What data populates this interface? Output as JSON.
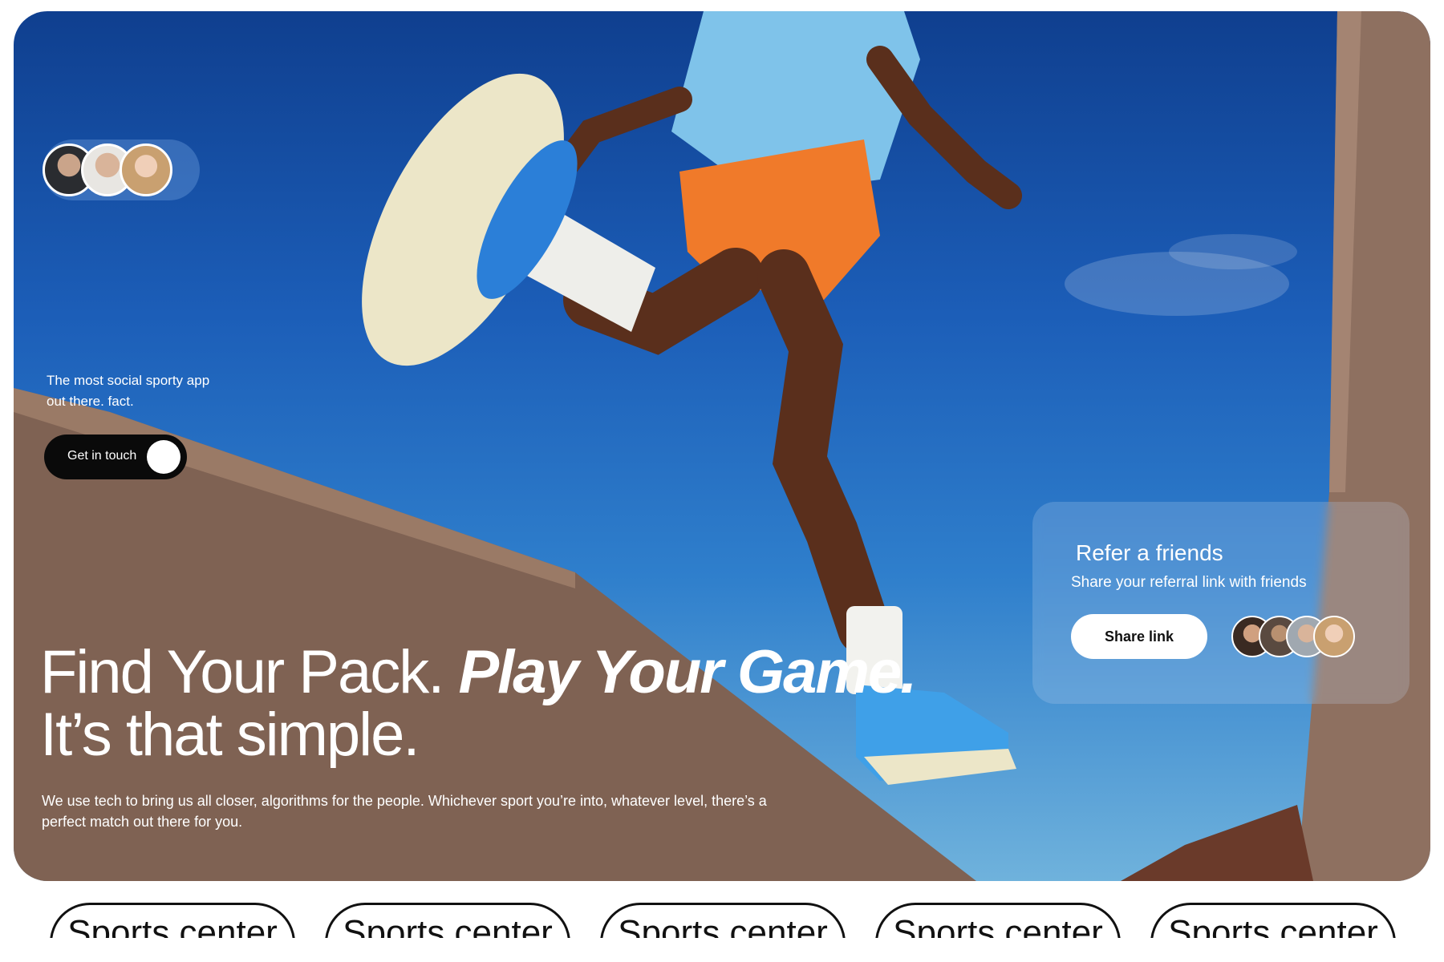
{
  "hero": {
    "tagline": "The most social sporty app out there. fact.",
    "cta_label": "Get in touch",
    "headline_plain": "Find Your Pack. ",
    "headline_emphasis": "Play Your Game.",
    "headline_line2": "It’s that simple.",
    "subtext": "We use tech to bring us all closer, algorithms for the people. Whichever sport you’re into, whatever level, there’s a perfect match out there for you."
  },
  "refer": {
    "title": "Refer a friends",
    "subtitle": "Share your referral link with friends",
    "share_label": "Share link"
  },
  "tags": [
    "Sports center",
    "Sports center",
    "Sports center",
    "Sports center",
    "Sports center"
  ],
  "colors": {
    "sky_top": "#0f3f8f",
    "sky_bottom": "#6fb2dc",
    "wall": "#8a6a58",
    "button_dark": "#0a0a0a",
    "shirt": "#7fc3ea",
    "shorts": "#f07a2a"
  }
}
